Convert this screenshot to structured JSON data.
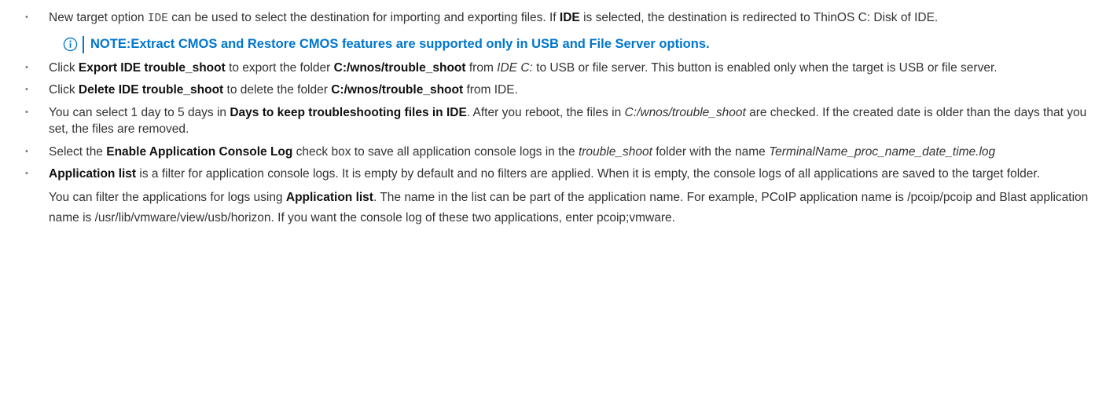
{
  "colors": {
    "note_blue": "#0076ce",
    "body_text": "#333333"
  },
  "bullet_glyph": "•",
  "b1": {
    "t1": "New target option ",
    "code": "IDE",
    "t2": " can be used to select the destination for importing and exporting files. If ",
    "bold": "IDE",
    "t3": " is selected, the destination is redirected to ThinOS C: Disk of IDE."
  },
  "note": {
    "icon": "info-circle-icon",
    "label": "NOTE:",
    "text": " Extract CMOS and Restore CMOS features are supported only in USB and File Server options."
  },
  "b2": {
    "t1": "Click ",
    "bold1": "Export IDE trouble_shoot",
    "t2": " to export the folder ",
    "bold2": "C:/wnos/trouble_shoot",
    "t3": " from ",
    "ital": "IDE C:",
    "t4": " to USB or file server. This button is enabled only when the target is USB or file server."
  },
  "b3": {
    "t1": "Click ",
    "bold1": "Delete IDE trouble_shoot",
    "t2": " to delete the folder ",
    "bold2": "C:/wnos/trouble_shoot",
    "t3": " from IDE."
  },
  "b4": {
    "t1": "You can select 1 day to 5 days in ",
    "bold": "Days to keep troubleshooting files in IDE",
    "t2": ". After you reboot, the files in ",
    "ital": "C:/wnos/trouble_shoot",
    "t3": " are checked. If the created date is older than the days that you set, the files are removed."
  },
  "b5": {
    "t1": "Select the ",
    "bold": "Enable Application Console Log",
    "t2": " check box to save all application console logs in the ",
    "ital1": "trouble_shoot",
    "t3": " folder with the name ",
    "ital2": "TerminalName_proc_name_date_time.log"
  },
  "b6": {
    "bold": "Application list",
    "t1": " is a filter for application console logs. It is empty by default and no filters are applied. When it is empty, the console logs of all applications are saved to the target folder."
  },
  "p7": {
    "t1": "You can filter the applications for logs using ",
    "bold": "Application list",
    "t2": ". The name in the list can be part of the application name. For example, PCoIP application name is /pcoip/pcoip and Blast application name is /usr/lib/vmware/view/usb/horizon. If you want the console log of these two applications, enter pcoip;vmware."
  }
}
